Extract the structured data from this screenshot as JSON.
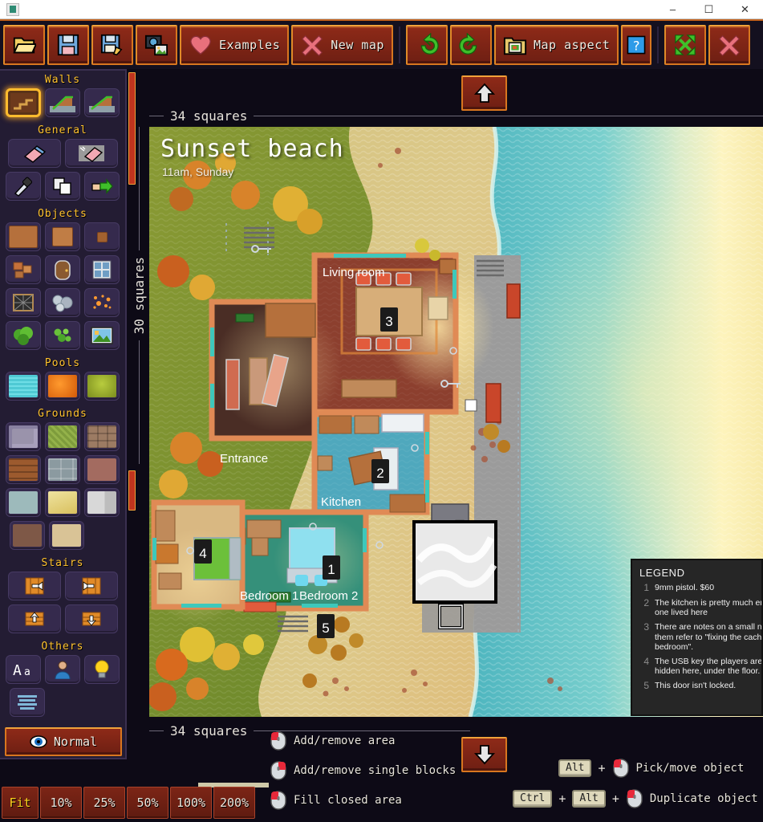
{
  "window": {
    "title": "",
    "icon": "app-icon",
    "minimize": "–",
    "maximize": "☐",
    "close": "✕"
  },
  "toolbar": {
    "buttons": [
      {
        "name": "open-file",
        "label": "",
        "icon": "folder-open-icon"
      },
      {
        "name": "save-file",
        "label": "",
        "icon": "floppy-disk-icon"
      },
      {
        "name": "save-as-file",
        "label": "",
        "icon": "floppy-disk-pencil-icon"
      },
      {
        "name": "export-image",
        "label": "",
        "icon": "camera-image-icon"
      },
      {
        "name": "examples",
        "label": "Examples",
        "icon": "heart-icon"
      },
      {
        "name": "new-map",
        "label": "New map",
        "icon": "cross-icon"
      },
      {
        "name": "undo",
        "label": "",
        "icon": "undo-arrow-icon"
      },
      {
        "name": "redo",
        "label": "",
        "icon": "redo-arrow-icon"
      },
      {
        "name": "map-aspect",
        "label": "Map aspect",
        "icon": "picture-frame-icon"
      },
      {
        "name": "help",
        "label": "",
        "icon": "question-mark-icon"
      },
      {
        "name": "fullscreen",
        "label": "",
        "icon": "expand-arrows-icon"
      },
      {
        "name": "quit",
        "label": "",
        "icon": "red-cross-icon"
      }
    ]
  },
  "palette": {
    "sections": [
      {
        "title": "Walls",
        "items": [
          {
            "name": "wall-straight",
            "icon": "wall-step-icon",
            "color": "#8a4a22",
            "selected": true
          },
          {
            "name": "wall-slope-up",
            "icon": "wall-slope-icon",
            "color": "#5a5a68",
            "selected": false
          },
          {
            "name": "wall-slope-down",
            "icon": "wall-slope-alt-icon",
            "color": "#5a5a68",
            "selected": false
          }
        ]
      },
      {
        "title": "General",
        "items": [
          {
            "name": "eraser",
            "icon": "eraser-icon",
            "color": "#4a6fa5",
            "selected": false
          },
          {
            "name": "eraser-area",
            "icon": "eraser-area-icon",
            "color": "#9a9a9a",
            "selected": false
          },
          {
            "name": "color-picker",
            "icon": "eyedropper-icon",
            "color": "#cfd4dc",
            "selected": false
          },
          {
            "name": "copy",
            "icon": "copy-pages-icon",
            "color": "#e8e8e8",
            "selected": false
          },
          {
            "name": "move",
            "icon": "hand-move-icon",
            "color": "#f2c9a0",
            "selected": false
          }
        ]
      },
      {
        "title": "Objects",
        "items": [
          {
            "name": "object-box-large",
            "icon": "wood-box-icon",
            "color": "#b5703c",
            "selected": false
          },
          {
            "name": "object-box-medium",
            "icon": "wood-crate-icon",
            "color": "#c07d45",
            "selected": false
          },
          {
            "name": "object-box-small",
            "icon": "wood-block-icon",
            "color": "#a2612f",
            "selected": false
          },
          {
            "name": "object-rubble",
            "icon": "rubble-icon",
            "color": "#c4703a",
            "selected": false
          },
          {
            "name": "object-door",
            "icon": "door-icon",
            "color": "#8a5a30",
            "selected": false
          },
          {
            "name": "object-window",
            "icon": "window-icon",
            "color": "#6f9ec4",
            "selected": false
          },
          {
            "name": "object-fence",
            "icon": "fence-net-icon",
            "color": "#2e2e2e",
            "selected": false
          },
          {
            "name": "object-rocks",
            "icon": "rocks-icon",
            "color": "#aab4c0",
            "selected": false
          },
          {
            "name": "object-sparks",
            "icon": "orange-dots-icon",
            "color": "#ff9a30",
            "selected": false
          },
          {
            "name": "object-tree",
            "icon": "tree-icon",
            "color": "#4aa62a",
            "selected": false
          },
          {
            "name": "object-bush",
            "icon": "bush-icon",
            "color": "#68c03a",
            "selected": false
          },
          {
            "name": "object-picture",
            "icon": "landscape-picture-icon",
            "color": "#7fc4e8",
            "selected": false
          }
        ]
      },
      {
        "title": "Pools",
        "items": [
          {
            "name": "pool-water",
            "icon": "water-pool-icon",
            "color": "#37bccb",
            "selected": false
          },
          {
            "name": "pool-lava",
            "icon": "lava-pool-icon",
            "color": "#e8700f",
            "selected": false
          },
          {
            "name": "pool-acid",
            "icon": "acid-pool-icon",
            "color": "#93a82c",
            "selected": false
          }
        ]
      },
      {
        "title": "Grounds",
        "items": [
          {
            "name": "ground-cobble",
            "icon": "cobblestone-icon",
            "color": "#9a93ab",
            "selected": false
          },
          {
            "name": "ground-grass",
            "icon": "grass-icon",
            "color": "#7e9c3c",
            "selected": false
          },
          {
            "name": "ground-brick-tan",
            "icon": "brick-tan-icon",
            "color": "#9c7b63",
            "selected": false
          },
          {
            "name": "ground-wood",
            "icon": "wood-plank-icon",
            "color": "#9c5a2e",
            "selected": false
          },
          {
            "name": "ground-stone-block",
            "icon": "stone-block-icon",
            "color": "#8b9aa0",
            "selected": false
          },
          {
            "name": "ground-clay",
            "icon": "clay-icon",
            "color": "#a36b60",
            "selected": false
          },
          {
            "name": "ground-tile-blue",
            "icon": "blue-tile-icon",
            "color": "#9dbabb",
            "selected": false
          },
          {
            "name": "ground-sand",
            "icon": "sand-icon",
            "color": "#e3d27a",
            "selected": false
          },
          {
            "name": "ground-concrete",
            "icon": "concrete-icon",
            "color": "#c8c8c8",
            "selected": false
          },
          {
            "name": "ground-dirt",
            "icon": "dirt-icon",
            "color": "#7e5847",
            "selected": false
          },
          {
            "name": "ground-plain",
            "icon": "plain-tan-icon",
            "color": "#d9c396",
            "selected": false
          }
        ]
      },
      {
        "title": "Stairs",
        "items": [
          {
            "name": "stairs-left",
            "icon": "stairs-left-icon",
            "color": "#e08a28",
            "selected": false
          },
          {
            "name": "stairs-right",
            "icon": "stairs-right-icon",
            "color": "#e08a28",
            "selected": false
          },
          {
            "name": "stairs-up",
            "icon": "stairs-up-icon",
            "color": "#e08a28",
            "selected": false
          },
          {
            "name": "stairs-down",
            "icon": "stairs-down-icon",
            "color": "#e08a28",
            "selected": false
          }
        ]
      },
      {
        "title": "Others",
        "items": [
          {
            "name": "text-tool",
            "icon": "text-aa-icon",
            "color": "#ffffff",
            "selected": false
          },
          {
            "name": "character-token",
            "icon": "person-icon",
            "color": "#2e7fc4",
            "selected": false
          },
          {
            "name": "light-source",
            "icon": "lightbulb-icon",
            "color": "#ffd21e",
            "selected": false
          },
          {
            "name": "legend-tool",
            "icon": "legend-lines-icon",
            "color": "#7fb7d8",
            "selected": false
          }
        ]
      }
    ],
    "mode_button": {
      "label": "Normal",
      "icon": "eye-icon"
    }
  },
  "map": {
    "title": "Sunset beach",
    "subtitle": "11am, Sunday",
    "width_label": "34 squares",
    "height_label": "30 squares",
    "bottom_width_label": "34 squares",
    "nav_up": "↑",
    "nav_down": "↓",
    "rooms": [
      {
        "name": "living-room",
        "label": "Living room"
      },
      {
        "name": "entrance",
        "label": "Entrance"
      },
      {
        "name": "kitchen",
        "label": "Kitchen"
      },
      {
        "name": "bedroom-1",
        "label": "Bedroom 1"
      },
      {
        "name": "bedroom-2",
        "label": "Bedroom 2"
      }
    ],
    "markers": [
      "1",
      "2",
      "3",
      "4",
      "5"
    ]
  },
  "legend": {
    "title": "LEGEND",
    "entries": [
      {
        "num": "1",
        "lines": [
          "9mm pistol. $60"
        ]
      },
      {
        "num": "2",
        "lines": [
          "The kitchen is pretty much em",
          "one lived here"
        ]
      },
      {
        "num": "3",
        "lines": [
          "There are notes on a small not",
          "them refer to \"fixing the cache",
          "bedroom\"."
        ]
      },
      {
        "num": "4",
        "lines": [
          "The USB key the players are loo",
          "hidden here, under the floor."
        ]
      },
      {
        "num": "5",
        "lines": [
          "This door isn't locked."
        ]
      }
    ]
  },
  "help": {
    "rows": [
      {
        "name": "help-add-remove-area",
        "keys": [],
        "mouse": "left-click",
        "label": "Add/remove area"
      },
      {
        "name": "help-add-remove-single",
        "keys": [],
        "mouse": "right-click",
        "label": "Add/remove single blocks"
      },
      {
        "name": "help-fill-closed",
        "keys": [],
        "mouse": "left-click",
        "label": "Fill closed area"
      },
      {
        "name": "help-pick-move",
        "keys": [
          "Alt"
        ],
        "mouse": "left-click",
        "label": "Pick/move object"
      },
      {
        "name": "help-duplicate",
        "keys": [
          "Ctrl",
          "Alt"
        ],
        "mouse": "left-click",
        "label": "Duplicate object"
      }
    ],
    "plus": "+"
  },
  "zoom": {
    "levels": [
      {
        "label": "Fit",
        "active": true
      },
      {
        "label": "10%",
        "active": false
      },
      {
        "label": "25%",
        "active": false
      },
      {
        "label": "50%",
        "active": false
      },
      {
        "label": "100%",
        "active": false
      },
      {
        "label": "200%",
        "active": false
      }
    ]
  },
  "colors": {
    "panel_bg": "#231c33",
    "button_red": "#8e2a18",
    "button_border": "#d8761f",
    "accent_yellow": "#ffc22e",
    "app_bg": "#0d0a16",
    "water": "#5bc3c8",
    "sand": "#d9c084",
    "grass": "#82992f"
  }
}
